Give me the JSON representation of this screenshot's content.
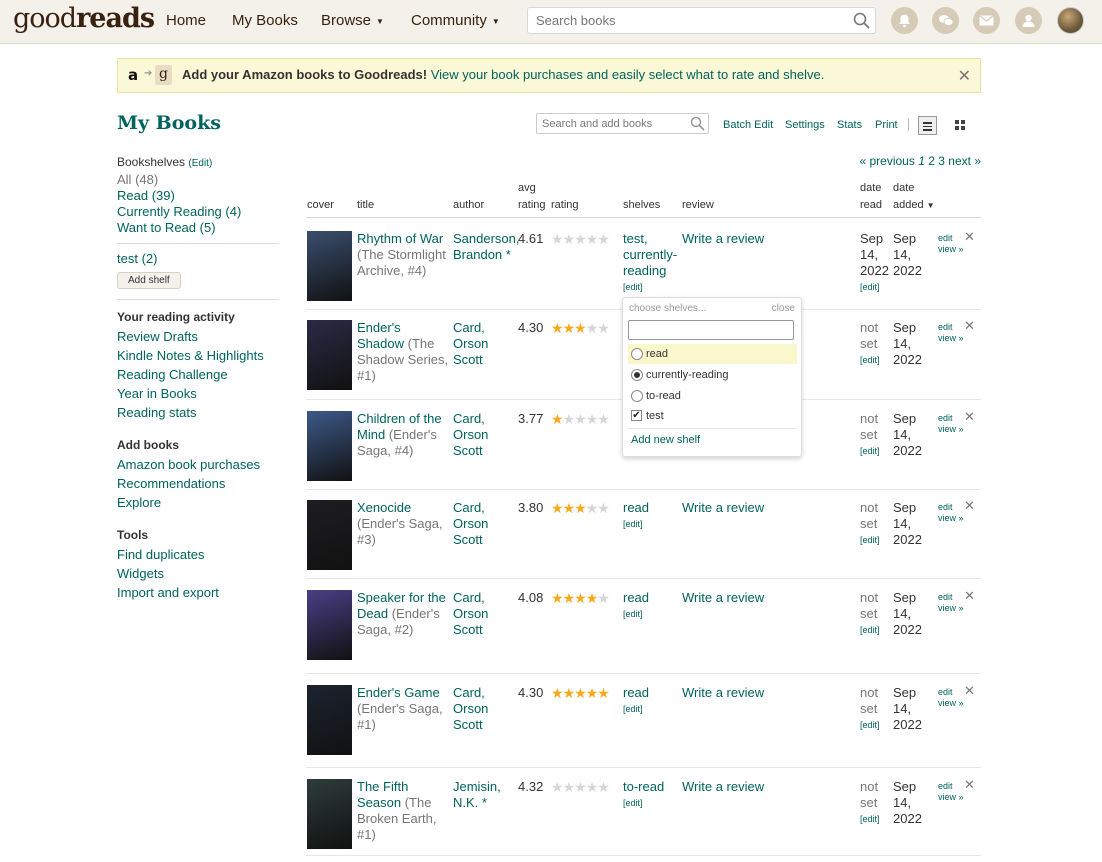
{
  "header": {
    "logo_light": "good",
    "logo_bold": "reads",
    "nav": [
      "Home",
      "My Books",
      "Browse",
      "Community"
    ],
    "search_placeholder": "Search books"
  },
  "banner": {
    "amazon_letter": "a",
    "goodreads_letter": "g",
    "bold": "Add your Amazon books to Goodreads!",
    "link": "View your book purchases and easily select what to rate and shelve."
  },
  "page": {
    "title": "My Books",
    "search_add_placeholder": "Search and add books",
    "tools": [
      "Batch Edit",
      "Settings",
      "Stats",
      "Print"
    ]
  },
  "sidebar": {
    "bookshelves_label": "Bookshelves",
    "bookshelves_edit": "(Edit)",
    "shelves": [
      {
        "label": "All",
        "count": "(48)"
      },
      {
        "label": "Read",
        "count": "(39)"
      },
      {
        "label": "Currently Reading",
        "count": "(4)"
      },
      {
        "label": "Want to Read",
        "count": "(5)"
      }
    ],
    "custom_shelf": {
      "label": "test",
      "count": "(2)"
    },
    "add_shelf": "Add shelf",
    "reading_activity_title": "Your reading activity",
    "reading_activity": [
      "Review Drafts",
      "Kindle Notes & Highlights",
      "Reading Challenge",
      "Year in Books",
      "Reading stats"
    ],
    "add_books_title": "Add books",
    "add_books": [
      "Amazon book purchases",
      "Recommendations",
      "Explore"
    ],
    "tools_title": "Tools",
    "tools": [
      "Find duplicates",
      "Widgets",
      "Import and export"
    ]
  },
  "pagination": {
    "previous": "« previous",
    "current": "1",
    "pages": [
      "2",
      "3"
    ],
    "next": "next »"
  },
  "columns": {
    "cover": "cover",
    "title": "title",
    "author": "author",
    "avg_rating_1": "avg",
    "avg_rating_2": "rating",
    "rating": "rating",
    "shelves": "shelves",
    "review": "review",
    "date_read_1": "date",
    "date_read_2": "read",
    "date_added_1": "date",
    "date_added_2": "added"
  },
  "books": [
    {
      "title": "Rhythm of War",
      "series": "(The Stormlight Archive, #4)",
      "author1": "Sanderson,",
      "author2": "Brandon *",
      "author3": "",
      "avg": "4.61",
      "stars": 0,
      "shelves": "test, currently-reading",
      "review": "Write a review",
      "read1": "Sep",
      "read2": "14,",
      "read3": "2022",
      "added1": "Sep",
      "added2": "14,",
      "added3": "2022",
      "cover_color": "#3a4f6e"
    },
    {
      "title": "Ender's Shadow",
      "series": "(The Shadow Series, #1)",
      "author1": "Card,",
      "author2": "Orson",
      "author3": "Scott",
      "avg": "4.30",
      "stars": 3,
      "shelves": "",
      "review": "",
      "read1": "not",
      "read2": "set",
      "read3": "",
      "added1": "Sep",
      "added2": "14,",
      "added3": "2022",
      "cover_color": "#2b2a45"
    },
    {
      "title": "Children of the Mind",
      "series": "(Ender's Saga, #4)",
      "author1": "Card,",
      "author2": "Orson",
      "author3": "Scott",
      "avg": "3.77",
      "stars": 1,
      "shelves": "",
      "review": "",
      "read1": "not",
      "read2": "set",
      "read3": "",
      "added1": "Sep",
      "added2": "14,",
      "added3": "2022",
      "cover_color": "#3d5a8a"
    },
    {
      "title": "Xenocide",
      "series": "(Ender's Saga, #3)",
      "author1": "Card,",
      "author2": "Orson",
      "author3": "Scott",
      "avg": "3.80",
      "stars": 3,
      "shelves": "read",
      "review": "Write a review",
      "read1": "not",
      "read2": "set",
      "read3": "",
      "added1": "Sep",
      "added2": "14,",
      "added3": "2022",
      "cover_color": "#1e1e22"
    },
    {
      "title": "Speaker for the Dead",
      "series": "(Ender's Saga, #2)",
      "author1": "Card,",
      "author2": "Orson",
      "author3": "Scott",
      "avg": "4.08",
      "stars": 4,
      "shelves": "read",
      "review": "Write a review",
      "read1": "not",
      "read2": "set",
      "read3": "",
      "added1": "Sep",
      "added2": "14,",
      "added3": "2022",
      "cover_color": "#4a3f86"
    },
    {
      "title": "Ender's Game",
      "series": "(Ender's Saga, #1)",
      "author1": "Card,",
      "author2": "Orson",
      "author3": "Scott",
      "avg": "4.30",
      "stars": 5,
      "shelves": "read",
      "review": "Write a review",
      "read1": "not",
      "read2": "set",
      "read3": "",
      "added1": "Sep",
      "added2": "14,",
      "added3": "2022",
      "cover_color": "#1c2430"
    },
    {
      "title": "The Fifth Season",
      "series": "(The Broken Earth, #1)",
      "author1": "Jemisin,",
      "author2": "N.K. *",
      "author3": "",
      "avg": "4.32",
      "stars": 0,
      "shelves": "to-read",
      "review": "Write a review",
      "read1": "not",
      "read2": "set",
      "read3": "",
      "added1": "Sep",
      "added2": "14,",
      "added3": "2022",
      "cover_color": "#2d3d3a"
    }
  ],
  "row_edit": "[edit]",
  "action_edit": "edit",
  "action_view": "view »",
  "dropdown": {
    "hint": "choose shelves...",
    "close": "close",
    "options": [
      {
        "label": "read",
        "type": "radio",
        "checked": false,
        "highlighted": true
      },
      {
        "label": "currently-reading",
        "type": "radio",
        "checked": true,
        "highlighted": false
      },
      {
        "label": "to-read",
        "type": "radio",
        "checked": false,
        "highlighted": false
      },
      {
        "label": "test",
        "type": "checkbox",
        "checked": true,
        "highlighted": false
      }
    ],
    "add_new": "Add new shelf"
  },
  "colors": {
    "accent": "#00635d",
    "header_bg": "#f4f1ea",
    "star": "#f7a91b",
    "banner_bg": "#fbf8d7"
  }
}
